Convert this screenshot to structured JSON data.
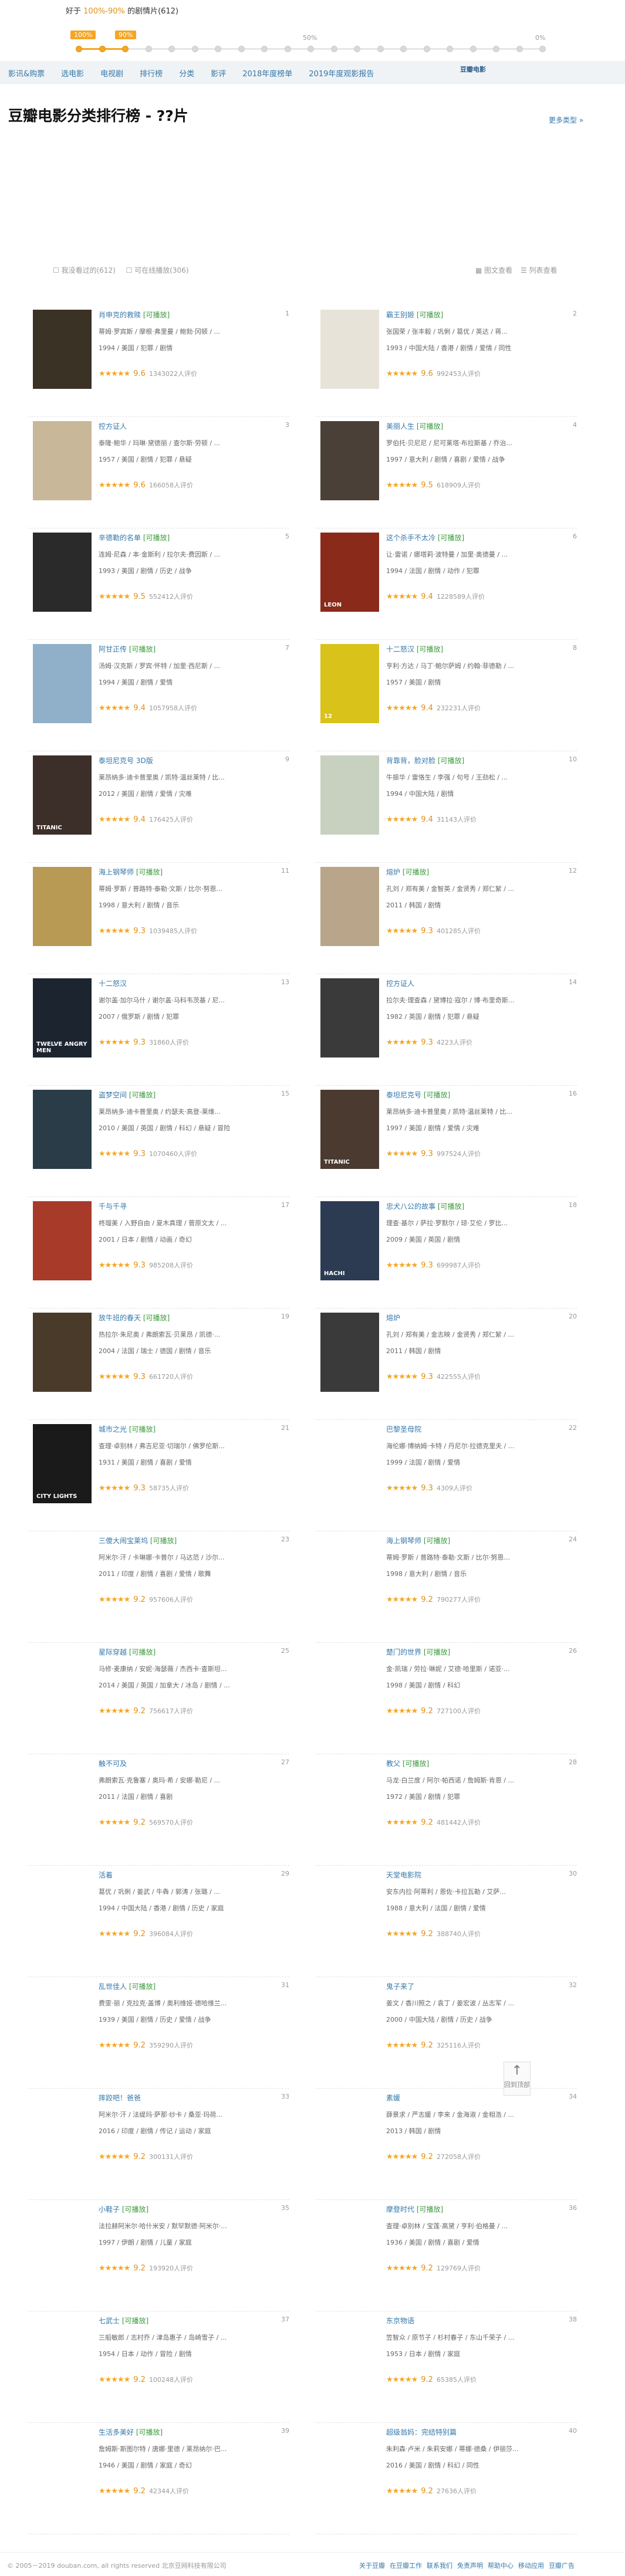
{
  "slider": {
    "prefix": "好于",
    "range": "100%-90%",
    "suffix": "的剧情片(612)",
    "handle_left": "100%",
    "handle_right": "90%",
    "mark_mid": "50%",
    "mark_end": "0%",
    "selected_fraction": 0.1
  },
  "nav": {
    "items": [
      "影讯&购票",
      "选电影",
      "电视剧",
      "排行榜",
      "分类",
      "影评",
      "2018年度榜单",
      "2019年度观影报告"
    ],
    "logo": "豆瓣电影"
  },
  "page": {
    "title": "豆瓣电影分类排行榜 - ??片",
    "more": "更多类型 »"
  },
  "filters": {
    "watched": "☐ 我没看过的(612)",
    "playable": "☐ 可在线播放(306)",
    "view_image": "▦ 图文查看",
    "view_list": "☰ 列表查看"
  },
  "colors": {
    "accent": "#f5a623",
    "link": "#3377aa",
    "playable": "#3a9a3a"
  },
  "movies": [
    {
      "rank": "1",
      "title": "肖申克的救赎",
      "tag": "[可播放]",
      "cast": "蒂姆·罗宾斯 / 摩根·弗里曼 / 鲍勃·冈顿 / ...",
      "meta": "1994 / 美国 / 犯罪 / 剧情",
      "score": "9.6",
      "votes": "1343022人评价",
      "poster": "#3b3226",
      "ptxt": ""
    },
    {
      "rank": "2",
      "title": "霸王别姬",
      "tag": "[可播放]",
      "cast": "张国荣 / 张丰毅 / 巩俐 / 葛优 / 英达 / 蒋...",
      "meta": "1993 / 中国大陆 / 香港 / 剧情 / 爱情 / 同性",
      "score": "9.6",
      "votes": "992453人评价",
      "poster": "#e8e3d8",
      "ptxt": ""
    },
    {
      "rank": "3",
      "title": "控方证人",
      "tag": "",
      "cast": "泰隆·鲍华 / 玛琳·黛德丽 / 查尔斯·劳顿 / ...",
      "meta": "1957 / 美国 / 剧情 / 犯罪 / 悬疑",
      "score": "9.6",
      "votes": "166058人评价",
      "poster": "#c9b79a",
      "ptxt": ""
    },
    {
      "rank": "4",
      "title": "美丽人生",
      "tag": "[可播放]",
      "cast": "罗伯托·贝尼尼 / 尼可莱塔·布拉斯基 / 乔治...",
      "meta": "1997 / 意大利 / 剧情 / 喜剧 / 爱情 / 战争",
      "score": "9.5",
      "votes": "618909人评价",
      "poster": "#4a4038",
      "ptxt": ""
    },
    {
      "rank": "5",
      "title": "辛德勒的名单",
      "tag": "[可播放]",
      "cast": "连姆·尼森 / 本·金斯利 / 拉尔夫·费因斯 / ...",
      "meta": "1993 / 美国 / 剧情 / 历史 / 战争",
      "score": "9.5",
      "votes": "552412人评价",
      "poster": "#2a2a2a",
      "ptxt": ""
    },
    {
      "rank": "6",
      "title": "这个杀手不太冷",
      "tag": "[可播放]",
      "cast": "让·雷诺 / 娜塔莉·波特曼 / 加里·奥德曼 / ...",
      "meta": "1994 / 法国 / 剧情 / 动作 / 犯罪",
      "score": "9.4",
      "votes": "1228589人评价",
      "poster": "#8a2a1a",
      "ptxt": "LEON"
    },
    {
      "rank": "7",
      "title": "阿甘正传",
      "tag": "[可播放]",
      "cast": "汤姆·汉克斯 / 罗宾·怀特 / 加里·西尼斯 / ...",
      "meta": "1994 / 美国 / 剧情 / 爱情",
      "score": "9.4",
      "votes": "1057958人评价",
      "poster": "#8fb0c8",
      "ptxt": ""
    },
    {
      "rank": "8",
      "title": "十二怒汉",
      "tag": "[可播放]",
      "cast": "亨利·方达 / 马丁·鲍尔萨姆 / 约翰·菲德勒 / ...",
      "meta": "1957 / 美国 / 剧情",
      "score": "9.4",
      "votes": "232231人评价",
      "poster": "#d9c21a",
      "ptxt": "12"
    },
    {
      "rank": "9",
      "title": "泰坦尼克号 3D版",
      "tag": "",
      "cast": "莱昂纳多·迪卡普里奥 / 凯特·温丝莱特 / 比...",
      "meta": "2012 / 美国 / 剧情 / 爱情 / 灾难",
      "score": "9.4",
      "votes": "176425人评价",
      "poster": "#3c2e28",
      "ptxt": "TITANIC"
    },
    {
      "rank": "10",
      "title": "背靠背，脸对脸",
      "tag": "[可播放]",
      "cast": "牛振华 / 雷恪生 / 李强 / 句号 / 王劲松 / ...",
      "meta": "1994 / 中国大陆 / 剧情",
      "score": "9.4",
      "votes": "31143人评价",
      "poster": "#c8d0c0",
      "ptxt": ""
    },
    {
      "rank": "11",
      "title": "海上钢琴师",
      "tag": "[可播放]",
      "cast": "蒂姆·罗斯 / 普路特·泰勒·文斯 / 比尔·努恩...",
      "meta": "1998 / 意大利 / 剧情 / 音乐",
      "score": "9.3",
      "votes": "1039485人评价",
      "poster": "#b89a55",
      "ptxt": ""
    },
    {
      "rank": "12",
      "title": "熔炉",
      "tag": "[可播放]",
      "cast": "孔刘 / 郑有美 / 金智英 / 金贤秀 / 郑仁絮 / ...",
      "meta": "2011 / 韩国 / 剧情",
      "score": "9.3",
      "votes": "401285人评价",
      "poster": "#b9a58a",
      "ptxt": ""
    },
    {
      "rank": "13",
      "title": "十二怒汉",
      "tag": "",
      "cast": "谢尔盖·加尔马什 / 谢尔盖·马科韦茨基 / 尼...",
      "meta": "2007 / 俄罗斯 / 剧情 / 犯罪",
      "score": "9.3",
      "votes": "31860人评价",
      "poster": "#1c2430",
      "ptxt": "TWELVE ANGRY MEN"
    },
    {
      "rank": "14",
      "title": "控方证人",
      "tag": "",
      "cast": "拉尔夫·理查森 / 黛博拉·寇尔 / 博·布里奇斯...",
      "meta": "1982 / 英国 / 剧情 / 犯罪 / 悬疑",
      "score": "9.3",
      "votes": "4223人评价",
      "poster": "#3a3a3a",
      "ptxt": ""
    },
    {
      "rank": "15",
      "title": "盗梦空间",
      "tag": "[可播放]",
      "cast": "莱昂纳多·迪卡普里奥 / 约瑟夫·高登-莱维...",
      "meta": "2010 / 美国 / 英国 / 剧情 / 科幻 / 悬疑 / 冒险",
      "score": "9.3",
      "votes": "1070460人评价",
      "poster": "#2a3c48",
      "ptxt": ""
    },
    {
      "rank": "16",
      "title": "泰坦尼克号",
      "tag": "[可播放]",
      "cast": "莱昂纳多·迪卡普里奥 / 凯特·温丝莱特 / 比...",
      "meta": "1997 / 美国 / 剧情 / 爱情 / 灾难",
      "score": "9.3",
      "votes": "997524人评价",
      "poster": "#4a3a30",
      "ptxt": "TITANIC"
    },
    {
      "rank": "17",
      "title": "千与千寻",
      "tag": "",
      "cast": "柊瑠美 / 入野自由 / 夏木真理 / 菅原文太 / ...",
      "meta": "2001 / 日本 / 剧情 / 动画 / 奇幻",
      "score": "9.3",
      "votes": "985208人评价",
      "poster": "#a83a2a",
      "ptxt": ""
    },
    {
      "rank": "18",
      "title": "忠犬八公的故事",
      "tag": "[可播放]",
      "cast": "理查·基尔 / 萨拉·罗默尔 / 琼·艾伦 / 罗比...",
      "meta": "2009 / 美国 / 英国 / 剧情",
      "score": "9.3",
      "votes": "699987人评价",
      "poster": "#2c3a52",
      "ptxt": "HACHI"
    },
    {
      "rank": "19",
      "title": "放牛班的春天",
      "tag": "[可播放]",
      "cast": "热拉尔·朱尼奥 / 弗朗索瓦·贝莱昂 / 凯德·...",
      "meta": "2004 / 法国 / 瑞士 / 德国 / 剧情 / 音乐",
      "score": "9.3",
      "votes": "661720人评价",
      "poster": "#4a3a2a",
      "ptxt": ""
    },
    {
      "rank": "20",
      "title": "熔炉",
      "tag": "",
      "cast": "孔刘 / 郑有美 / 金志映 / 金贤秀 / 郑仁絮 / ...",
      "meta": "2011 / 韩国 / 剧情",
      "score": "9.3",
      "votes": "422555人评价",
      "poster": "#3a3a3a",
      "ptxt": ""
    },
    {
      "rank": "21",
      "title": "城市之光",
      "tag": "[可播放]",
      "cast": "查理·卓别林 / 弗吉尼亚·切瑞尔 / 佛罗伦斯...",
      "meta": "1931 / 美国 / 剧情 / 喜剧 / 爱情",
      "score": "9.3",
      "votes": "58735人评价",
      "poster": "#1a1a1a",
      "ptxt": "CITY LIGHTS"
    },
    {
      "rank": "22",
      "title": "巴黎圣母院",
      "tag": "",
      "cast": "海伦娜·博纳姆·卡特 / 丹尼尔·拉德克里夫 / ...",
      "meta": "1999 / 法国 / 剧情 / 爱情",
      "score": "9.3",
      "votes": "4309人评价",
      "poster": "",
      "ptxt": ""
    },
    {
      "rank": "23",
      "title": "三傻大闹宝莱坞",
      "tag": "[可播放]",
      "cast": "阿米尔·汗 / 卡琳娜·卡普尔 / 马达范 / 沙尔...",
      "meta": "2011 / 印度 / 剧情 / 喜剧 / 爱情 / 歌舞",
      "score": "9.2",
      "votes": "957606人评价",
      "poster": "",
      "ptxt": ""
    },
    {
      "rank": "24",
      "title": "海上钢琴师",
      "tag": "[可播放]",
      "cast": "蒂姆·罗斯 / 普路特·泰勒·文斯 / 比尔·努恩...",
      "meta": "1998 / 意大利 / 剧情 / 音乐",
      "score": "9.2",
      "votes": "790277人评价",
      "poster": "",
      "ptxt": ""
    },
    {
      "rank": "25",
      "title": "星际穿越",
      "tag": "[可播放]",
      "cast": "马修·麦康纳 / 安妮·海瑟薇 / 杰西卡·查斯坦...",
      "meta": "2014 / 美国 / 英国 / 加拿大 / 冰岛 / 剧情 / ...",
      "score": "9.2",
      "votes": "756617人评价",
      "poster": "",
      "ptxt": ""
    },
    {
      "rank": "26",
      "title": "楚门的世界",
      "tag": "[可播放]",
      "cast": "金·凯瑞 / 劳拉·琳妮 / 艾德·哈里斯 / 诺亚·...",
      "meta": "1998 / 美国 / 剧情 / 科幻",
      "score": "9.2",
      "votes": "727100人评价",
      "poster": "",
      "ptxt": ""
    },
    {
      "rank": "27",
      "title": "触不可及",
      "tag": "",
      "cast": "弗朗索瓦·克鲁塞 / 奥玛·希 / 安娜·勒尼 / ...",
      "meta": "2011 / 法国 / 剧情 / 喜剧",
      "score": "9.2",
      "votes": "569570人评价",
      "poster": "",
      "ptxt": ""
    },
    {
      "rank": "28",
      "title": "教父",
      "tag": "[可播放]",
      "cast": "马龙·白兰度 / 阿尔·帕西诺 / 詹姆斯·肯恩 / ...",
      "meta": "1972 / 美国 / 剧情 / 犯罪",
      "score": "9.2",
      "votes": "481442人评价",
      "poster": "",
      "ptxt": ""
    },
    {
      "rank": "29",
      "title": "活着",
      "tag": "",
      "cast": "葛优 / 巩俐 / 姜武 / 牛犇 / 郭涛 / 张璐 / ...",
      "meta": "1994 / 中国大陆 / 香港 / 剧情 / 历史 / 家庭",
      "score": "9.2",
      "votes": "396084人评价",
      "poster": "",
      "ptxt": ""
    },
    {
      "rank": "30",
      "title": "天堂电影院",
      "tag": "",
      "cast": "安东内拉·阿蒂利 / 恩佐·卡拉瓦勒 / 艾萨...",
      "meta": "1988 / 意大利 / 法国 / 剧情 / 爱情",
      "score": "9.2",
      "votes": "388740人评价",
      "poster": "",
      "ptxt": ""
    },
    {
      "rank": "31",
      "title": "乱世佳人",
      "tag": "[可播放]",
      "cast": "费雯·丽 / 克拉克·盖博 / 奥利维娅·德哈维兰...",
      "meta": "1939 / 美国 / 剧情 / 历史 / 爱情 / 战争",
      "score": "9.2",
      "votes": "359290人评价",
      "poster": "",
      "ptxt": ""
    },
    {
      "rank": "32",
      "title": "鬼子来了",
      "tag": "",
      "cast": "姜文 / 香川照之 / 袁丁 / 姜宏波 / 丛志军 / ...",
      "meta": "2000 / 中国大陆 / 剧情 / 历史 / 战争",
      "score": "9.2",
      "votes": "325116人评价",
      "poster": "",
      "ptxt": ""
    },
    {
      "rank": "33",
      "title": "摔跤吧！爸爸",
      "tag": "",
      "cast": "阿米尔·汗 / 法缇玛·萨那·纱卡 / 桑亚·玛荷...",
      "meta": "2016 / 印度 / 剧情 / 传记 / 运动 / 家庭",
      "score": "9.2",
      "votes": "300131人评价",
      "poster": "",
      "ptxt": ""
    },
    {
      "rank": "34",
      "title": "素媛",
      "tag": "",
      "cast": "薛景求 / 严志媛 / 李来 / 金海淑 / 金相浩 / ...",
      "meta": "2013 / 韩国 / 剧情",
      "score": "9.2",
      "votes": "272058人评价",
      "poster": "",
      "ptxt": ""
    },
    {
      "rank": "35",
      "title": "小鞋子",
      "tag": "[可播放]",
      "cast": "法拉赫阿米尔·哈什米安 / 默罕默德·阿米尔·...",
      "meta": "1997 / 伊朗 / 剧情 / 儿童 / 家庭",
      "score": "9.2",
      "votes": "193920人评价",
      "poster": "",
      "ptxt": ""
    },
    {
      "rank": "36",
      "title": "摩登时代",
      "tag": "[可播放]",
      "cast": "查理·卓别林 / 宝莲·高黛 / 亨利·伯格曼 / ...",
      "meta": "1936 / 美国 / 剧情 / 喜剧 / 爱情",
      "score": "9.2",
      "votes": "129769人评价",
      "poster": "",
      "ptxt": ""
    },
    {
      "rank": "37",
      "title": "七武士",
      "tag": "[可播放]",
      "cast": "三船敏郎 / 志村乔 / 津岛惠子 / 岛崎雪子 / ...",
      "meta": "1954 / 日本 / 动作 / 冒险 / 剧情",
      "score": "9.2",
      "votes": "100248人评价",
      "poster": "",
      "ptxt": ""
    },
    {
      "rank": "38",
      "title": "东京物语",
      "tag": "",
      "cast": "笠智众 / 原节子 / 杉村春子 / 东山千荣子 / ...",
      "meta": "1953 / 日本 / 剧情 / 家庭",
      "score": "9.2",
      "votes": "65385人评价",
      "poster": "",
      "ptxt": ""
    },
    {
      "rank": "39",
      "title": "生活多美好",
      "tag": "[可播放]",
      "cast": "詹姆斯·斯图尔特 / 唐娜·里德 / 莱昂纳尔·巴...",
      "meta": "1946 / 美国 / 剧情 / 家庭 / 奇幻",
      "score": "9.2",
      "votes": "42344人评价",
      "poster": "",
      "ptxt": ""
    },
    {
      "rank": "40",
      "title": "超级翁妈：完结特别篇",
      "tag": "",
      "cast": "朱利森·卢米 / 朱莉安娜 / 蒂娜·德桑 / 伊丽莎...",
      "meta": "2016 / 美国 / 剧情 / 科幻 / 同性",
      "score": "9.2",
      "votes": "27636人评价",
      "poster": "",
      "ptxt": ""
    }
  ],
  "backtop": {
    "label": "回到顶部"
  },
  "footer": {
    "copy": "© 2005－2019 douban.com, all rights reserved 北京豆网科技有限公司",
    "links": [
      "关于豆瓣",
      "在豆瓣工作",
      "联系我们",
      "免责声明",
      "帮助中心",
      "移动应用",
      "豆瓣广告"
    ]
  }
}
